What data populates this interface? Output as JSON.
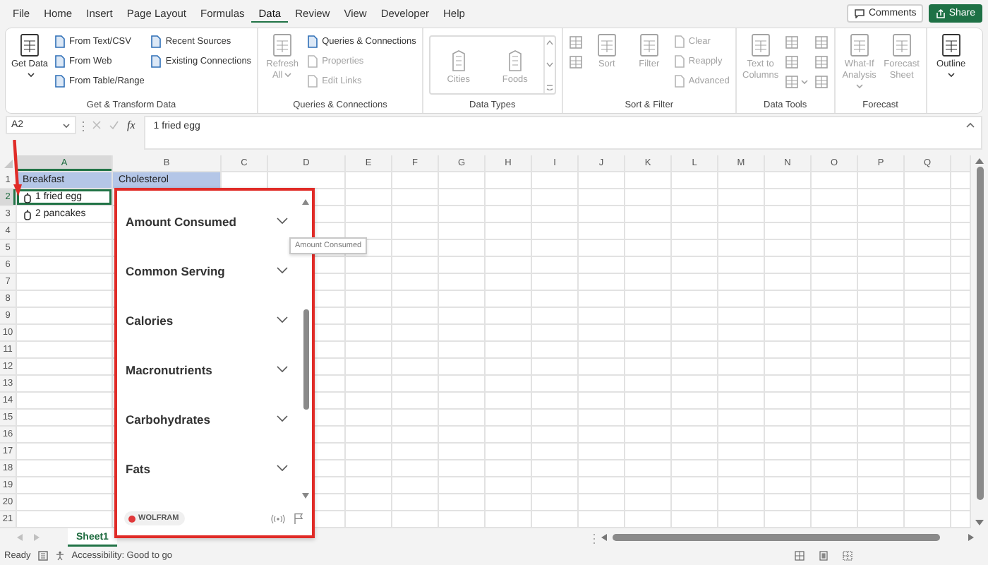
{
  "menu_tabs": [
    {
      "label": "File",
      "selected": false
    },
    {
      "label": "Home",
      "selected": false
    },
    {
      "label": "Insert",
      "selected": false
    },
    {
      "label": "Page Layout",
      "selected": false
    },
    {
      "label": "Formulas",
      "selected": false
    },
    {
      "label": "Data",
      "selected": true
    },
    {
      "label": "Review",
      "selected": false
    },
    {
      "label": "View",
      "selected": false
    },
    {
      "label": "Developer",
      "selected": false
    },
    {
      "label": "Help",
      "selected": false
    }
  ],
  "comments_button": {
    "label": "Comments"
  },
  "share_button": {
    "label": "Share"
  },
  "ribbon": {
    "groups": [
      {
        "label": "Get & Transform Data",
        "columns": [
          [
            {
              "kind": "large",
              "label": "Get Data",
              "dropdown": true,
              "disabled": false
            }
          ],
          [
            {
              "kind": "small",
              "label": "From Text/CSV",
              "disabled": false
            },
            {
              "kind": "small",
              "label": "From Web",
              "disabled": false
            },
            {
              "kind": "small",
              "label": "From Table/Range",
              "disabled": false
            }
          ],
          [
            {
              "kind": "small",
              "label": "Recent Sources",
              "disabled": false
            },
            {
              "kind": "small",
              "label": "Existing Connections",
              "disabled": false
            }
          ]
        ]
      },
      {
        "label": "Queries & Connections",
        "columns": [
          [
            {
              "kind": "large",
              "label": "Refresh All",
              "dropdown": true,
              "disabled": true
            }
          ],
          [
            {
              "kind": "small",
              "label": "Queries & Connections",
              "disabled": false
            },
            {
              "kind": "small",
              "label": "Properties",
              "disabled": true
            },
            {
              "kind": "small",
              "label": "Edit Links",
              "disabled": true
            }
          ]
        ]
      },
      {
        "label": "Data Types",
        "columns": [
          [
            {
              "kind": "gallery",
              "disabled": true,
              "options": [
                {
                  "label": "Cities"
                },
                {
                  "label": "Foods"
                }
              ]
            }
          ]
        ]
      },
      {
        "label": "Sort & Filter",
        "columns": [
          [
            {
              "kind": "icon",
              "dropdown": false,
              "disabled": true
            },
            {
              "kind": "icon",
              "dropdown": false,
              "disabled": true
            }
          ],
          [
            {
              "kind": "large",
              "label": "Sort",
              "dropdown": false,
              "disabled": true
            }
          ],
          [
            {
              "kind": "large",
              "label": "Filter",
              "dropdown": false,
              "disabled": true
            }
          ],
          [
            {
              "kind": "small",
              "label": "Clear",
              "disabled": true
            },
            {
              "kind": "small",
              "label": "Reapply",
              "disabled": true
            },
            {
              "kind": "small",
              "label": "Advanced",
              "disabled": true
            }
          ]
        ]
      },
      {
        "label": "Data Tools",
        "columns": [
          [
            {
              "kind": "large",
              "label": "Text to Columns",
              "dropdown": false,
              "disabled": true
            }
          ],
          [
            {
              "kind": "icon",
              "dropdown": false,
              "disabled": true
            },
            {
              "kind": "icon",
              "dropdown": false,
              "disabled": true
            },
            {
              "kind": "icon",
              "dropdown": true,
              "disabled": true
            }
          ],
          [
            {
              "kind": "icon",
              "dropdown": false,
              "disabled": true
            },
            {
              "kind": "icon",
              "dropdown": false,
              "disabled": true
            },
            {
              "kind": "icon",
              "dropdown": false,
              "disabled": true
            }
          ]
        ]
      },
      {
        "label": "Forecast",
        "columns": [
          [
            {
              "kind": "large",
              "label": "What-If Analysis",
              "dropdown": true,
              "disabled": true
            }
          ],
          [
            {
              "kind": "large",
              "label": "Forecast Sheet",
              "dropdown": false,
              "disabled": true
            }
          ]
        ]
      },
      {
        "columns": [
          [
            {
              "kind": "large",
              "label": "Outline",
              "dropdown": true,
              "disabled": false
            }
          ]
        ]
      }
    ]
  },
  "formula_bar": {
    "name_box": "A2",
    "function_label": "fx",
    "value": "1 fried egg"
  },
  "grid": {
    "columns": [
      {
        "label": "A",
        "selected": true
      },
      {
        "label": "B",
        "selected": false
      },
      {
        "label": "C",
        "selected": false
      },
      {
        "label": "D",
        "selected": false
      },
      {
        "label": "E",
        "selected": false
      },
      {
        "label": "F",
        "selected": false
      },
      {
        "label": "G",
        "selected": false
      },
      {
        "label": "H",
        "selected": false
      },
      {
        "label": "I",
        "selected": false
      },
      {
        "label": "J",
        "selected": false
      },
      {
        "label": "K",
        "selected": false
      },
      {
        "label": "L",
        "selected": false
      },
      {
        "label": "M",
        "selected": false
      },
      {
        "label": "N",
        "selected": false
      },
      {
        "label": "O",
        "selected": false
      },
      {
        "label": "P",
        "selected": false
      },
      {
        "label": "Q",
        "selected": false
      }
    ],
    "rows": [
      {
        "label": "1",
        "selected": false,
        "cells": [
          {
            "text": "Breakfast",
            "kind": "header",
            "selected": false
          },
          {
            "text": "Cholesterol",
            "kind": "header",
            "selected": false
          }
        ]
      },
      {
        "label": "2",
        "selected": true,
        "cells": [
          {
            "text": "1 fried egg",
            "kind": "food",
            "selected": true
          }
        ]
      },
      {
        "label": "3",
        "selected": false,
        "cells": [
          {
            "text": "2 pancakes",
            "kind": "food",
            "selected": false
          }
        ]
      },
      {
        "label": "4",
        "selected": false
      },
      {
        "label": "5",
        "selected": false
      },
      {
        "label": "6",
        "selected": false
      },
      {
        "label": "7",
        "selected": false
      },
      {
        "label": "8",
        "selected": false
      },
      {
        "label": "9",
        "selected": false
      },
      {
        "label": "10",
        "selected": false
      },
      {
        "label": "11",
        "selected": false
      },
      {
        "label": "12",
        "selected": false
      },
      {
        "label": "13",
        "selected": false
      },
      {
        "label": "14",
        "selected": false
      },
      {
        "label": "15",
        "selected": false
      },
      {
        "label": "16",
        "selected": false
      },
      {
        "label": "17",
        "selected": false
      },
      {
        "label": "18",
        "selected": false
      },
      {
        "label": "19",
        "selected": false
      },
      {
        "label": "20",
        "selected": false
      },
      {
        "label": "21",
        "selected": false
      }
    ]
  },
  "data_card": {
    "sections": [
      {
        "label": "Amount Consumed",
        "expanded": false
      },
      {
        "label": "Common Serving",
        "expanded": false
      },
      {
        "label": "Calories",
        "expanded": false
      },
      {
        "label": "Macronutrients",
        "expanded": false
      },
      {
        "label": "Carbohydrates",
        "expanded": false
      },
      {
        "label": "Fats",
        "expanded": false
      }
    ],
    "brand": "WOLFRAM"
  },
  "tooltip": {
    "text": "Amount Consumed"
  },
  "sheet_tabs": [
    {
      "label": "Sheet1",
      "selected": true
    }
  ],
  "status_bar": {
    "ready": "Ready",
    "accessibility": "Accessibility: Good to go"
  }
}
